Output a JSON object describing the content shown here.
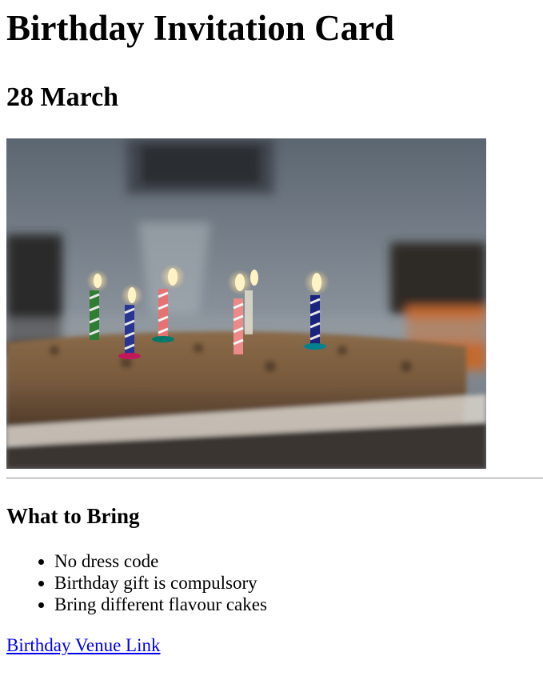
{
  "page": {
    "title": "Birthday Invitation Card",
    "date": "28 March"
  },
  "photo": {
    "subject": "birthday cake with lit candles",
    "candle_colors": [
      "#2e7d32",
      "#283593",
      "#e57373",
      "#ec8a8a",
      "#1565c0"
    ]
  },
  "bring": {
    "heading": "What to Bring",
    "items": [
      "No dress code",
      "Birthday gift is compulsory",
      "Bring different flavour cakes"
    ]
  },
  "venue": {
    "link_text": "Birthday Venue Link"
  },
  "colors": {
    "link": "#0000ee",
    "text": "#000000",
    "background": "#ffffff"
  }
}
